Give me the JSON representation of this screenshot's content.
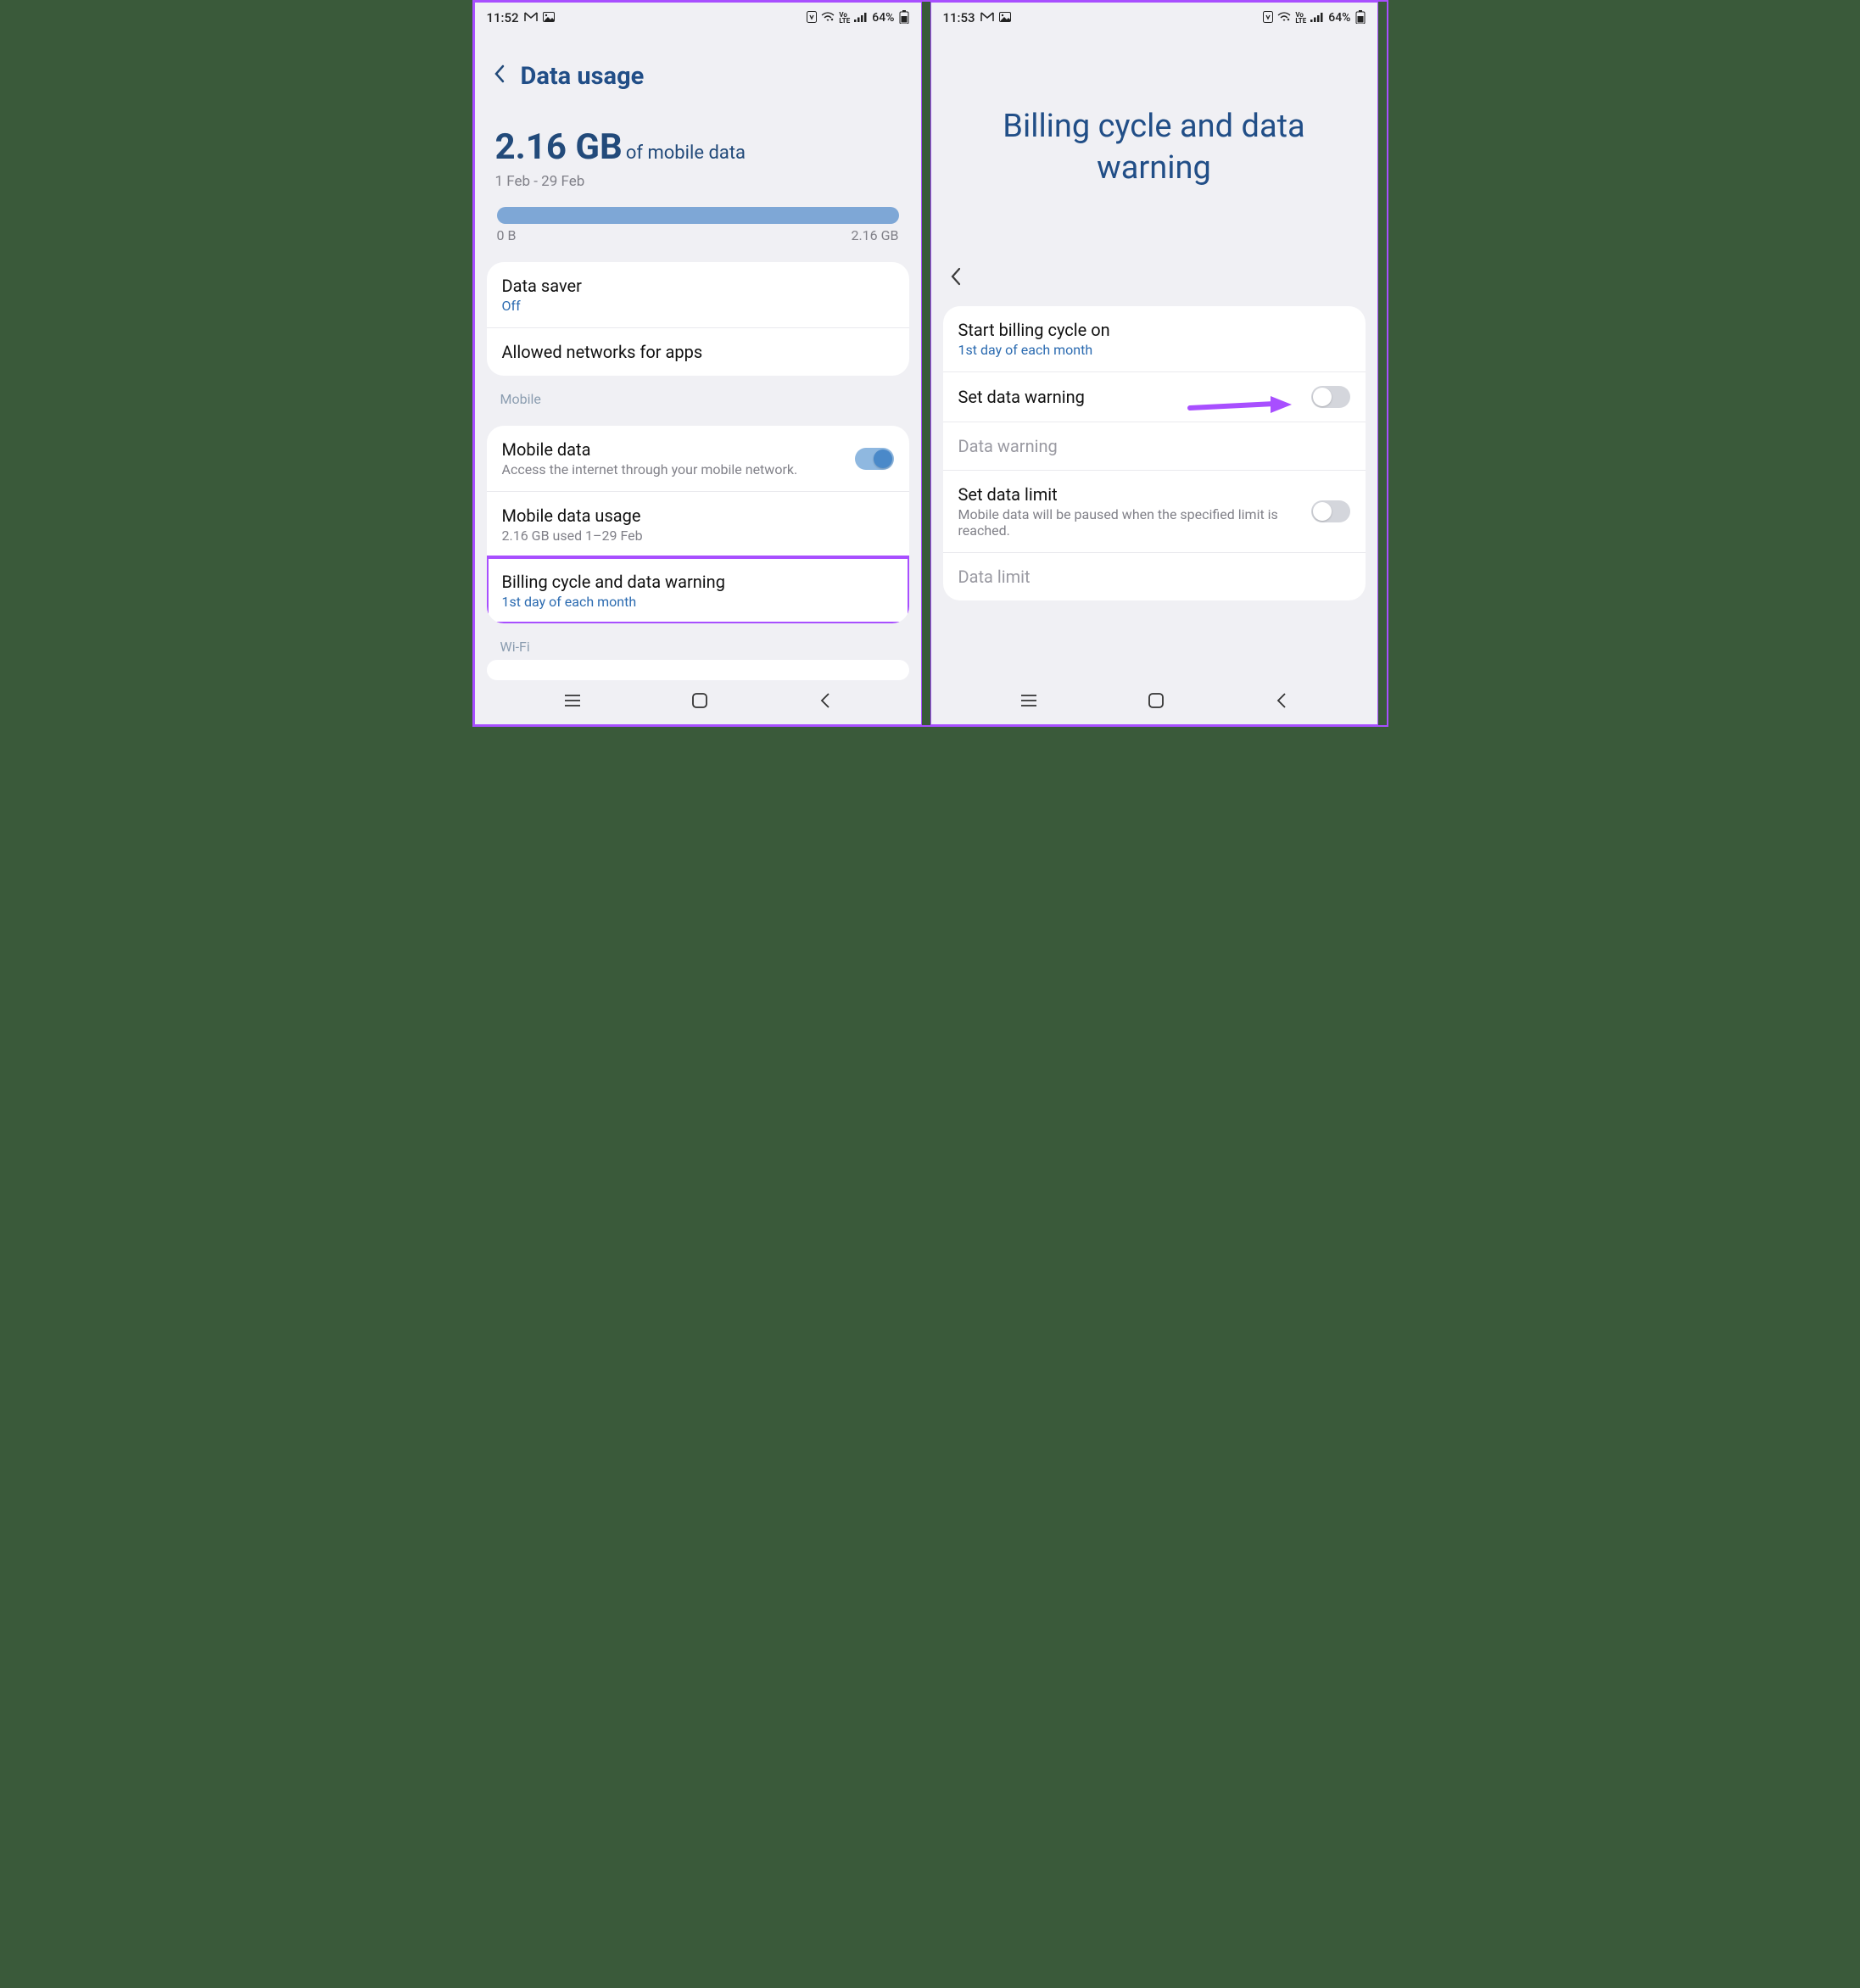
{
  "left": {
    "status": {
      "time": "11:52",
      "battery": "64%"
    },
    "header": {
      "title": "Data usage"
    },
    "usage": {
      "amount": "2.16 GB",
      "suffix": "of mobile data",
      "range": "1 Feb - 29 Feb",
      "bar_start": "0 B",
      "bar_end": "2.16 GB"
    },
    "card1": {
      "r1": {
        "title": "Data saver",
        "sub": "Off"
      },
      "r2": {
        "title": "Allowed networks for apps"
      }
    },
    "section_mobile": "Mobile",
    "card2": {
      "r1": {
        "title": "Mobile data",
        "sub": "Access the internet through your mobile network."
      },
      "r2": {
        "title": "Mobile data usage",
        "sub": "2.16 GB used 1–29 Feb"
      },
      "r3": {
        "title": "Billing cycle and data warning",
        "sub": "1st day of each month"
      }
    },
    "section_wifi": "Wi-Fi"
  },
  "right": {
    "status": {
      "time": "11:53",
      "battery": "64%"
    },
    "big_title": "Billing cycle and data warning",
    "card": {
      "r1": {
        "title": "Start billing cycle on",
        "sub": "1st day of each month"
      },
      "r2": {
        "title": "Set data warning"
      },
      "r3": {
        "title": "Data warning"
      },
      "r4": {
        "title": "Set data limit",
        "sub": "Mobile data will be paused when the specified limit is reached."
      },
      "r5": {
        "title": "Data limit"
      }
    }
  }
}
